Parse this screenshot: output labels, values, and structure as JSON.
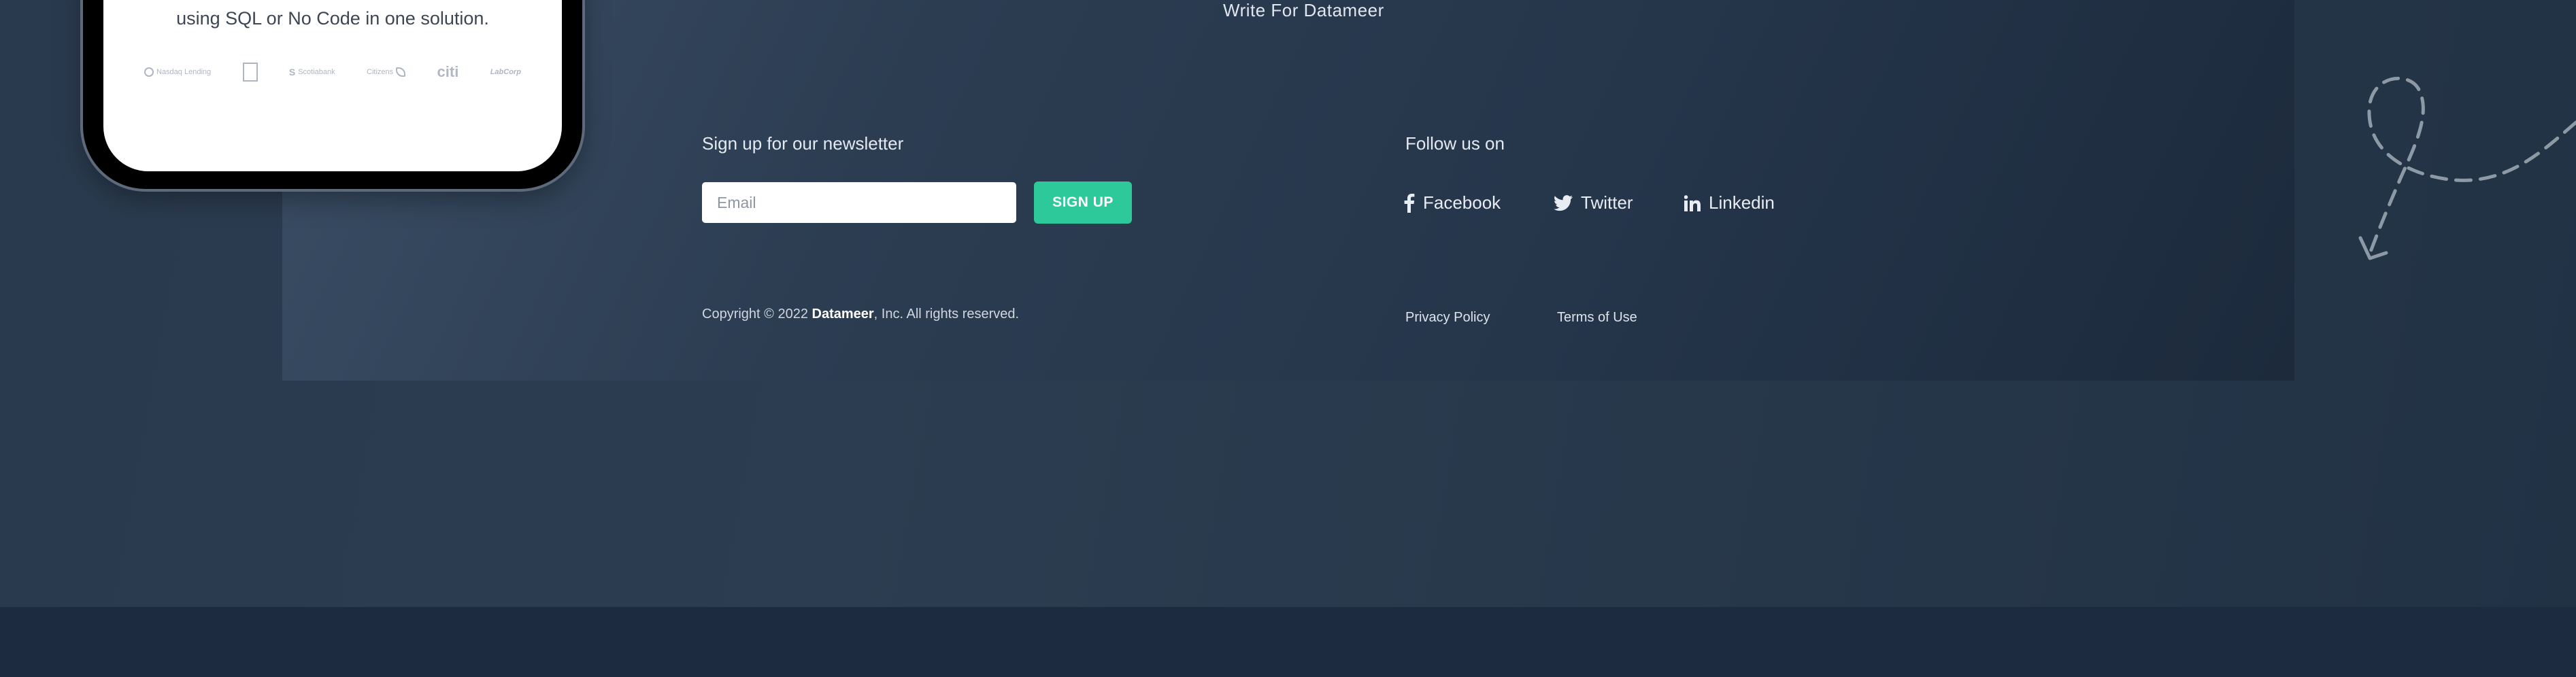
{
  "top_link": "Write For Datameer",
  "phone": {
    "tagline": "using SQL or No Code in one solution.",
    "logos": [
      {
        "name": "Nasdaq Lending",
        "icon": "logo-circle"
      },
      {
        "name": "",
        "icon": "logo-doc"
      },
      {
        "name": "Scotiabank",
        "icon": "logo-s"
      },
      {
        "name": "Citizens",
        "icon": "logo-leaf"
      },
      {
        "name": "citi",
        "icon": "logo-citi"
      },
      {
        "name": "LabCorp",
        "icon": "logo-labcorp"
      }
    ]
  },
  "newsletter": {
    "title": "Sign up for our newsletter",
    "email_placeholder": "Email",
    "button_label": "SIGN UP"
  },
  "copyright": {
    "prefix": "Copyright © 2022 ",
    "company": "Datameer",
    "suffix": ", Inc. All rights reserved."
  },
  "follow": {
    "title": "Follow us on",
    "links": [
      {
        "label": "Facebook",
        "icon": "facebook-icon"
      },
      {
        "label": "Twitter",
        "icon": "twitter-icon"
      },
      {
        "label": "Linkedin",
        "icon": "linkedin-icon"
      }
    ]
  },
  "legal": {
    "privacy": "Privacy Policy",
    "terms": "Terms of Use"
  },
  "colors": {
    "accent": "#2ec99a",
    "background": "#2a3a4e",
    "panel": "#2c3d52",
    "bottom_band": "#1c2b3f"
  }
}
